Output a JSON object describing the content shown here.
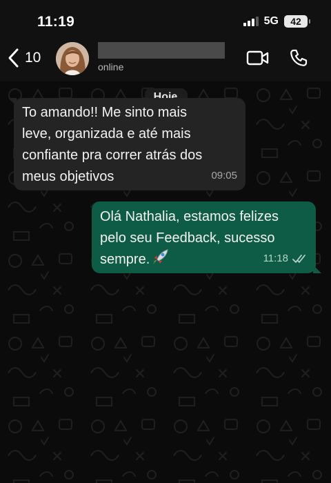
{
  "status_bar": {
    "time": "11:19",
    "network": "5G",
    "battery": "42"
  },
  "header": {
    "back_count": "10",
    "contact_status": "online",
    "icons": [
      "chevron-left-icon",
      "video-icon",
      "phone-icon"
    ]
  },
  "chat": {
    "date_label": "Hoje",
    "messages": [
      {
        "direction": "incoming",
        "text": "To amando!! Me sinto mais\nleve, organizada e até mais\nconfiante pra correr atrás dos\nmeus objetivos",
        "time": "09:05"
      },
      {
        "direction": "outgoing",
        "text": "Olá Nathalia, estamos felizes\npelo seu Feedback, sucesso\nsempre.",
        "emoji": "rocket-icon",
        "time": "11:18",
        "read_receipt": "double-check-icon"
      }
    ]
  },
  "colors": {
    "background": "#0b0b0b",
    "incoming_bubble": "#242424",
    "outgoing_bubble": "#0e5c45",
    "read_receipt": "#b6d3c7"
  }
}
